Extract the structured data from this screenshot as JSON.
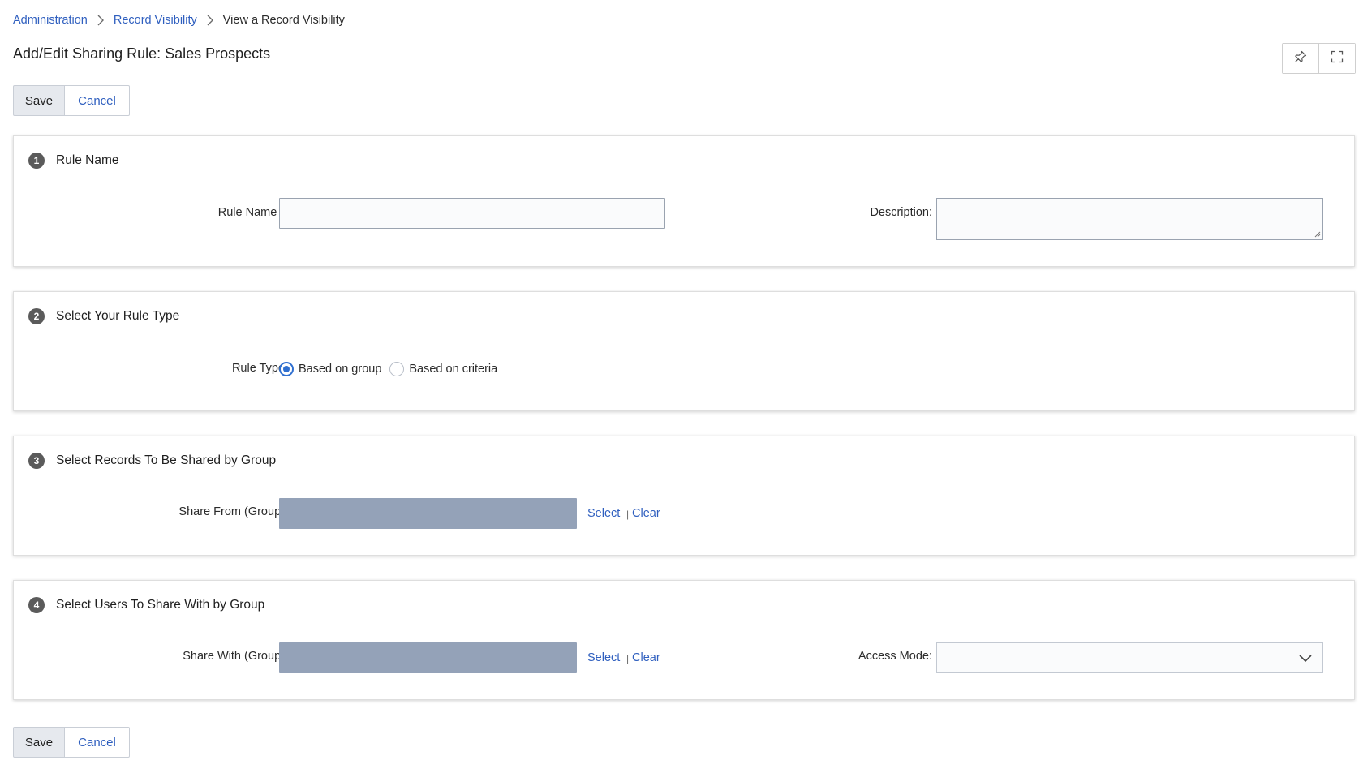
{
  "breadcrumb": {
    "items": [
      "Administration",
      "Record Visibility"
    ],
    "current": "View a Record Visibility"
  },
  "page": {
    "title": "Add/Edit Sharing Rule: Sales Prospects"
  },
  "toolbar": {
    "save_label": "Save",
    "cancel_label": "Cancel"
  },
  "sections": [
    {
      "number": "1",
      "title": "Rule Name",
      "rule_name_label": "Rule Name *:",
      "rule_name_value": "",
      "description_label": "Description:",
      "description_value": ""
    },
    {
      "number": "2",
      "title": "Select Your Rule Type",
      "rule_type_label": "Rule Type:",
      "options": [
        "Based on group",
        "Based on criteria"
      ],
      "selected": "Based on group"
    },
    {
      "number": "3",
      "title": "Select Records To Be Shared by Group",
      "share_from_label": "Share From (Group):",
      "select_link": "Select",
      "clear_link": "Clear"
    },
    {
      "number": "4",
      "title": "Select Users To Share With by Group",
      "share_with_label": "Share With (Group):",
      "select_link": "Select",
      "clear_link": "Clear",
      "access_mode_label": "Access Mode:",
      "access_mode_value": ""
    }
  ],
  "icons": {
    "pin": "pin-icon",
    "fullscreen": "fullscreen-icon",
    "chevron_right": "chevron-right-icon",
    "chevron_down": "chevron-down-icon"
  },
  "colors": {
    "link": "#2f5fbf",
    "radio_selected": "#2f6fd0",
    "group_field": "#94a2b8",
    "save_button_bg": "#e6e9ee"
  }
}
